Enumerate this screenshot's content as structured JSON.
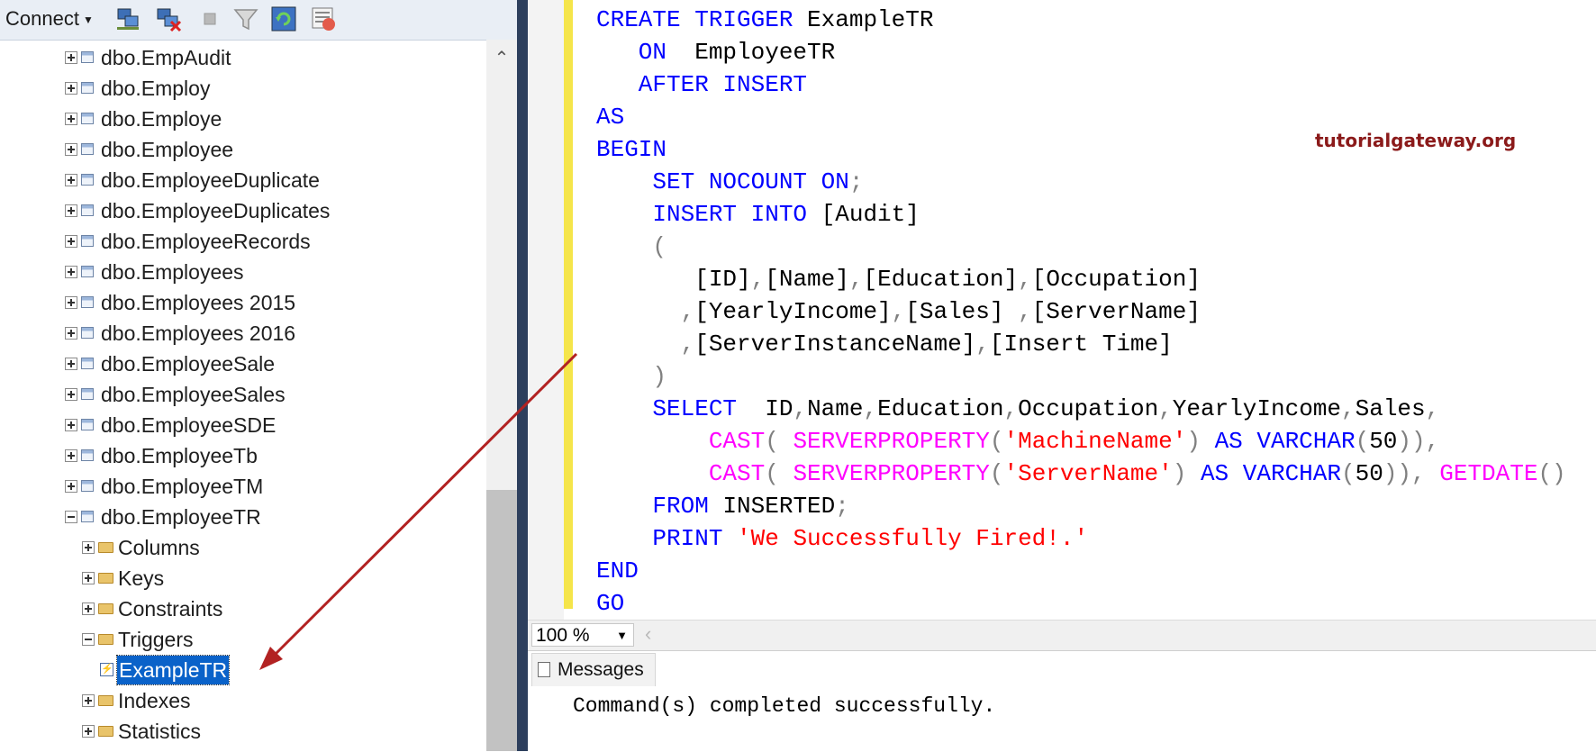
{
  "explorer": {
    "connect_label": "Connect",
    "toolbar_icons": [
      "connect-object-explorer-icon",
      "disconnect-icon",
      "stop-icon",
      "filter-icon",
      "refresh-icon",
      "object-explorer-details-icon"
    ],
    "tree": [
      {
        "label": "dbo.EmpAudit",
        "type": "table",
        "expanded": false
      },
      {
        "label": "dbo.Employ",
        "type": "table",
        "expanded": false
      },
      {
        "label": "dbo.Employe",
        "type": "table",
        "expanded": false
      },
      {
        "label": "dbo.Employee",
        "type": "table",
        "expanded": false
      },
      {
        "label": "dbo.EmployeeDuplicate",
        "type": "table",
        "expanded": false
      },
      {
        "label": "dbo.EmployeeDuplicates",
        "type": "table",
        "expanded": false
      },
      {
        "label": "dbo.EmployeeRecords",
        "type": "table",
        "expanded": false
      },
      {
        "label": "dbo.Employees",
        "type": "table",
        "expanded": false
      },
      {
        "label": "dbo.Employees 2015",
        "type": "table",
        "expanded": false
      },
      {
        "label": "dbo.Employees 2016",
        "type": "table",
        "expanded": false
      },
      {
        "label": "dbo.EmployeeSale",
        "type": "table",
        "expanded": false
      },
      {
        "label": "dbo.EmployeeSales",
        "type": "table",
        "expanded": false
      },
      {
        "label": "dbo.EmployeeSDE",
        "type": "table",
        "expanded": false
      },
      {
        "label": "dbo.EmployeeTb",
        "type": "table",
        "expanded": false
      },
      {
        "label": "dbo.EmployeeTM",
        "type": "table",
        "expanded": false
      },
      {
        "label": "dbo.EmployeeTR",
        "type": "table",
        "expanded": true
      },
      {
        "label": "Columns",
        "type": "folder",
        "expanded": false
      },
      {
        "label": "Keys",
        "type": "folder",
        "expanded": false
      },
      {
        "label": "Constraints",
        "type": "folder",
        "expanded": false
      },
      {
        "label": "Triggers",
        "type": "folder",
        "expanded": true
      },
      {
        "label": "ExampleTR",
        "type": "trigger",
        "selected": true
      },
      {
        "label": "Indexes",
        "type": "folder",
        "expanded": false
      },
      {
        "label": "Statistics",
        "type": "folder",
        "expanded": false
      }
    ]
  },
  "editor": {
    "code_lines": [
      [
        {
          "t": "CREATE TRIGGER ",
          "c": "kw"
        },
        {
          "t": "ExampleTR",
          "c": ""
        }
      ],
      [
        {
          "t": "   ON  ",
          "c": "kw"
        },
        {
          "t": "EmployeeTR",
          "c": ""
        }
      ],
      [
        {
          "t": "   AFTER INSERT",
          "c": "kw"
        }
      ],
      [
        {
          "t": "AS",
          "c": "kw"
        }
      ],
      [
        {
          "t": "BEGIN",
          "c": "kw"
        }
      ],
      [
        {
          "t": "    SET NOCOUNT ON",
          "c": "kw"
        },
        {
          "t": ";",
          "c": "gr"
        }
      ],
      [
        {
          "t": "    INSERT INTO ",
          "c": "kw"
        },
        {
          "t": "[Audit]",
          "c": ""
        }
      ],
      [
        {
          "t": "    (",
          "c": "gr"
        }
      ],
      [
        {
          "t": "       [ID]",
          "c": ""
        },
        {
          "t": ",",
          "c": "gr"
        },
        {
          "t": "[Name]",
          "c": ""
        },
        {
          "t": ",",
          "c": "gr"
        },
        {
          "t": "[Education]",
          "c": ""
        },
        {
          "t": ",",
          "c": "gr"
        },
        {
          "t": "[Occupation]",
          "c": ""
        }
      ],
      [
        {
          "t": "      ,",
          "c": "gr"
        },
        {
          "t": "[YearlyIncome]",
          "c": ""
        },
        {
          "t": ",",
          "c": "gr"
        },
        {
          "t": "[Sales] ",
          "c": ""
        },
        {
          "t": ",",
          "c": "gr"
        },
        {
          "t": "[ServerName]",
          "c": ""
        }
      ],
      [
        {
          "t": "      ,",
          "c": "gr"
        },
        {
          "t": "[ServerInstanceName]",
          "c": ""
        },
        {
          "t": ",",
          "c": "gr"
        },
        {
          "t": "[Insert Time]",
          "c": ""
        }
      ],
      [
        {
          "t": "    )",
          "c": "gr"
        }
      ],
      [
        {
          "t": "    SELECT  ",
          "c": "kw"
        },
        {
          "t": "ID",
          "c": ""
        },
        {
          "t": ",",
          "c": "gr"
        },
        {
          "t": "Name",
          "c": ""
        },
        {
          "t": ",",
          "c": "gr"
        },
        {
          "t": "Education",
          "c": ""
        },
        {
          "t": ",",
          "c": "gr"
        },
        {
          "t": "Occupation",
          "c": ""
        },
        {
          "t": ",",
          "c": "gr"
        },
        {
          "t": "YearlyIncome",
          "c": ""
        },
        {
          "t": ",",
          "c": "gr"
        },
        {
          "t": "Sales",
          "c": ""
        },
        {
          "t": ",",
          "c": "gr"
        }
      ],
      [
        {
          "t": "        CAST",
          "c": "fn"
        },
        {
          "t": "( ",
          "c": "gr"
        },
        {
          "t": "SERVERPROPERTY",
          "c": "fn"
        },
        {
          "t": "(",
          "c": "gr"
        },
        {
          "t": "'MachineName'",
          "c": "st"
        },
        {
          "t": ") ",
          "c": "gr"
        },
        {
          "t": "AS VARCHAR",
          "c": "kw"
        },
        {
          "t": "(",
          "c": "gr"
        },
        {
          "t": "50",
          "c": ""
        },
        {
          "t": ")),",
          "c": "gr"
        }
      ],
      [
        {
          "t": "        CAST",
          "c": "fn"
        },
        {
          "t": "( ",
          "c": "gr"
        },
        {
          "t": "SERVERPROPERTY",
          "c": "fn"
        },
        {
          "t": "(",
          "c": "gr"
        },
        {
          "t": "'ServerName'",
          "c": "st"
        },
        {
          "t": ") ",
          "c": "gr"
        },
        {
          "t": "AS VARCHAR",
          "c": "kw"
        },
        {
          "t": "(",
          "c": "gr"
        },
        {
          "t": "50",
          "c": ""
        },
        {
          "t": ")), ",
          "c": "gr"
        },
        {
          "t": "GETDATE",
          "c": "fn"
        },
        {
          "t": "()",
          "c": "gr"
        }
      ],
      [
        {
          "t": "    FROM ",
          "c": "kw"
        },
        {
          "t": "INSERTED",
          "c": ""
        },
        {
          "t": ";",
          "c": "gr"
        }
      ],
      [
        {
          "t": "    PRINT ",
          "c": "kw"
        },
        {
          "t": "'We Successfully Fired!.'",
          "c": "st"
        }
      ],
      [
        {
          "t": "END",
          "c": "kw"
        }
      ],
      [
        {
          "t": "GO",
          "c": "kw"
        }
      ]
    ],
    "watermark": "tutorialgateway.org"
  },
  "zoom": {
    "value": "100 %"
  },
  "messages": {
    "tab_label": "Messages",
    "text": "Command(s) completed successfully."
  },
  "colors": {
    "keyword": "#0000ff",
    "function": "#ff00ff",
    "string": "#ff0000",
    "operator": "#808080",
    "selection": "#0a62c9",
    "change_bar": "#f5e54a",
    "arrow": "#b22222"
  }
}
